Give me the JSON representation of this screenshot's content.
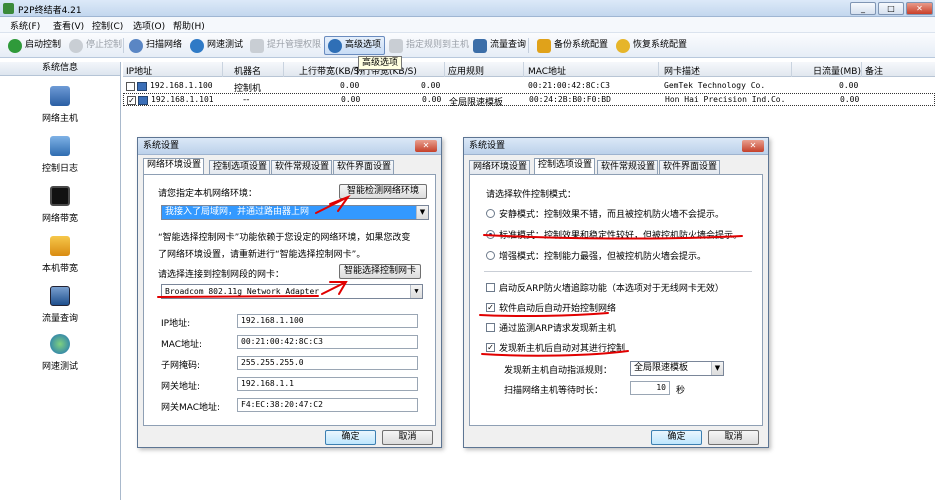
{
  "window": {
    "title": "P2P终结者4.21",
    "minimize": "_",
    "maximize": "□",
    "close": "✕"
  },
  "menu": [
    "系统(F)",
    "查看(V)",
    "控制(C)",
    "选项(O)",
    "帮助(H)"
  ],
  "toolbar": {
    "start": "启动控制",
    "stop": "停止控制",
    "scan": "扫描网络",
    "speed": "网速测试",
    "perm": "提升管理权限",
    "advanced": "高级选项",
    "rules": "指定规则到主机",
    "traffic": "流量查询",
    "backup": "备份系统配置",
    "restore": "恢复系统配置",
    "tooltip": "高级选项"
  },
  "sidebar": {
    "header": "系统信息",
    "items": [
      {
        "label": "网络主机",
        "icon": "host-icon"
      },
      {
        "label": "控制日志",
        "icon": "log-icon"
      },
      {
        "label": "网络带宽",
        "icon": "bandwidth-icon"
      },
      {
        "label": "本机带宽",
        "icon": "local-bandwidth-icon"
      },
      {
        "label": "流量查询",
        "icon": "traffic-icon"
      },
      {
        "label": "网速测试",
        "icon": "globe-icon"
      }
    ]
  },
  "grid": {
    "columns": [
      "IP地址",
      "机器名",
      "上行带宽(KB/S)",
      "下行带宽(KB/S)",
      "应用规则",
      "MAC地址",
      "网卡描述",
      "日流量(MB)",
      "备注"
    ],
    "rows": [
      {
        "checked": false,
        "ip": "192.168.1.100",
        "name": "控制机",
        "up": "0.00",
        "down": "0.00",
        "rule": "",
        "mac": "00:21:00:42:8C:C3",
        "nic": "GemTek Technology Co.",
        "daily": "0.00",
        "note": ""
      },
      {
        "checked": true,
        "ip": "192.168.1.101",
        "name": "--",
        "up": "0.00",
        "down": "0.00",
        "rule": "全局限速模板",
        "mac": "00:24:2B:B0:F0:BD",
        "nic": "Hon Hai Precision Ind.Co.",
        "daily": "0.00",
        "note": ""
      }
    ]
  },
  "dialog1": {
    "title": "系统设置",
    "tabs": [
      "网络环境设置",
      "控制选项设置",
      "软件常规设置",
      "软件界面设置"
    ],
    "env_prompt": "请您指定本机网络环境：",
    "detect_btn": "智能检测网络环境",
    "env_value": "我接入了局域网，并通过路由器上网",
    "note_line1": "“智能选择控制网卡”功能依赖于您设定的网络环境，如果您改变",
    "note_line2": "了网络环境设置，请重新进行“智能选择控制网卡”。",
    "nic_prompt": "请选择连接到控制网段的网卡：",
    "nic_btn": "智能选择控制网卡",
    "nic_value": "Broadcom 802.11g Network Adapter",
    "fields": [
      {
        "label": "IP地址:",
        "value": "192.168.1.100"
      },
      {
        "label": "MAC地址:",
        "value": "00:21:00:42:8C:C3"
      },
      {
        "label": "子网掩码:",
        "value": "255.255.255.0"
      },
      {
        "label": "网关地址:",
        "value": "192.168.1.1"
      },
      {
        "label": "网关MAC地址:",
        "value": "F4:EC:38:20:47:C2"
      }
    ],
    "ok": "确定",
    "cancel": "取消"
  },
  "dialog2": {
    "title": "系统设置",
    "tabs": [
      "网络环境设置",
      "控制选项设置",
      "软件常规设置",
      "软件界面设置"
    ],
    "mode_prompt": "请选择软件控制模式：",
    "modes": [
      {
        "label": "安静模式：控制效果不错，而且被控机防火墙不会提示。",
        "selected": false
      },
      {
        "label": "标准模式：控制效果和稳定性较好，但被控机防火墙会提示。",
        "selected": true
      },
      {
        "label": "增强模式：控制能力最强，但被控机防火墙会提示。",
        "selected": false
      }
    ],
    "options": [
      {
        "label": "启动反ARP防火墙追踪功能（本选项对于无线网卡无效）",
        "checked": false
      },
      {
        "label": "软件启动后自动开始控制网络",
        "checked": true
      },
      {
        "label": "通过监测ARP请求发现新主机",
        "checked": false
      },
      {
        "label": "发现新主机后自动对其进行控制",
        "checked": true
      }
    ],
    "rule_label": "发现新主机自动指派规则：",
    "rule_value": "全局限速模板",
    "scan_label": "扫描网络主机等待时长：",
    "scan_value": "10",
    "scan_unit": "秒",
    "ok": "确定",
    "cancel": "取消"
  },
  "colors": {
    "annotation": "#e10000",
    "selection": "#3399ff",
    "titlebar": "#c3d7ee"
  }
}
